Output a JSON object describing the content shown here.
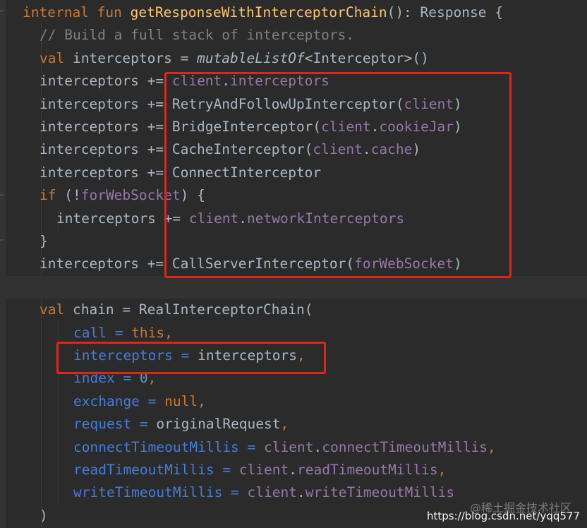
{
  "colors": {
    "background": "#2b2b2b",
    "keyword": "#cc7832",
    "function": "#ffc66d",
    "identifier": "#a9b7c6",
    "comment": "#808080",
    "property": "#9876aa",
    "named_argument": "#467cda",
    "number": "#6897bb",
    "highlight_box": "#e0251d"
  },
  "code": {
    "lines": [
      [
        [
          "kw",
          "internal fun "
        ],
        [
          "fn",
          "getResponseWithInterceptorChain"
        ],
        [
          "id",
          "(): Response {"
        ]
      ],
      [
        [
          "cmt",
          "// Build a full stack of interceptors."
        ]
      ],
      [
        [
          "kw",
          "val "
        ],
        [
          "id",
          "interceptors = "
        ],
        [
          "it",
          "mutableListOf"
        ],
        [
          "id",
          "<Interceptor>()"
        ]
      ],
      [
        [
          "id",
          "interceptors += "
        ],
        [
          "prop",
          "client"
        ],
        [
          "id",
          "."
        ],
        [
          "prop",
          "interceptors"
        ]
      ],
      [
        [
          "id",
          "interceptors += RetryAndFollowUpInterceptor("
        ],
        [
          "prop",
          "client"
        ],
        [
          "id",
          ")"
        ]
      ],
      [
        [
          "id",
          "interceptors += BridgeInterceptor("
        ],
        [
          "prop",
          "client"
        ],
        [
          "id",
          "."
        ],
        [
          "prop",
          "cookieJar"
        ],
        [
          "id",
          ")"
        ]
      ],
      [
        [
          "id",
          "interceptors += CacheInterceptor("
        ],
        [
          "prop",
          "client"
        ],
        [
          "id",
          "."
        ],
        [
          "prop",
          "cache"
        ],
        [
          "id",
          ")"
        ]
      ],
      [
        [
          "id",
          "interceptors += ConnectInterceptor"
        ]
      ],
      [
        [
          "kw",
          "if "
        ],
        [
          "id",
          "(!"
        ],
        [
          "prop",
          "forWebSocket"
        ],
        [
          "id",
          ") {"
        ]
      ],
      [
        [
          "id",
          "interceptors += "
        ],
        [
          "prop",
          "client"
        ],
        [
          "id",
          "."
        ],
        [
          "prop",
          "networkInterceptors"
        ]
      ],
      [
        [
          "id",
          "}"
        ]
      ],
      [
        [
          "id",
          "interceptors += CallServerInterceptor("
        ],
        [
          "prop",
          "forWebSocket"
        ],
        [
          "id",
          ")"
        ]
      ],
      [],
      [
        [
          "kw",
          "val "
        ],
        [
          "id",
          "chain = RealInterceptorChain("
        ]
      ],
      [
        [
          "named",
          "call = "
        ],
        [
          "kw",
          "this,"
        ]
      ],
      [
        [
          "named",
          "interceptors = "
        ],
        [
          "id",
          "interceptors"
        ],
        [
          "kw",
          ","
        ]
      ],
      [
        [
          "named",
          "index = "
        ],
        [
          "num",
          "0"
        ],
        [
          "kw",
          ","
        ]
      ],
      [
        [
          "named",
          "exchange = "
        ],
        [
          "kw",
          "null,"
        ]
      ],
      [
        [
          "named",
          "request = "
        ],
        [
          "id",
          "originalRequest"
        ],
        [
          "kw",
          ","
        ]
      ],
      [
        [
          "named",
          "connectTimeoutMillis = "
        ],
        [
          "prop",
          "client"
        ],
        [
          "id",
          "."
        ],
        [
          "prop",
          "connectTimeoutMillis"
        ],
        [
          "kw",
          ","
        ]
      ],
      [
        [
          "named",
          "readTimeoutMillis = "
        ],
        [
          "prop",
          "client"
        ],
        [
          "id",
          "."
        ],
        [
          "prop",
          "readTimeoutMillis"
        ],
        [
          "kw",
          ","
        ]
      ],
      [
        [
          "named",
          "writeTimeoutMillis = "
        ],
        [
          "prop",
          "client"
        ],
        [
          "id",
          "."
        ],
        [
          "prop",
          "writeTimeoutMillis"
        ]
      ],
      [
        [
          "id",
          ")"
        ]
      ]
    ]
  },
  "watermark": {
    "site": "@稀土掘金技术社区",
    "url": "https://blog.csdn.net/yqq577"
  }
}
